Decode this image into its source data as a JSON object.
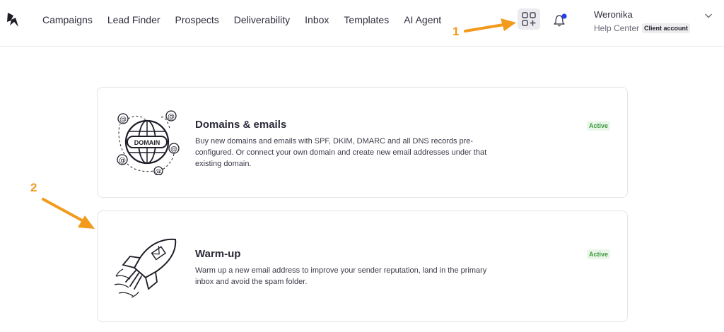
{
  "nav": {
    "items": [
      {
        "label": "Campaigns"
      },
      {
        "label": "Lead Finder"
      },
      {
        "label": "Prospects"
      },
      {
        "label": "Deliverability"
      },
      {
        "label": "Inbox"
      },
      {
        "label": "Templates"
      },
      {
        "label": "AI Agent"
      }
    ]
  },
  "header": {
    "logo_icon": "bird-logo-icon",
    "apps_icon": "apps-grid-plus-icon",
    "notifications_icon": "bell-icon",
    "notification_dot_color": "#2540e6"
  },
  "user": {
    "name": "Weronika",
    "help_center": "Help Center",
    "account_badge": "Client account"
  },
  "cards": [
    {
      "title": "Domains & emails",
      "description": "Buy new domains and emails with SPF, DKIM, DMARC and all DNS records pre-configured. Or connect your own domain and create new email addresses under that existing domain.",
      "status": "Active",
      "illustration_label": "DOMAIN",
      "illustration_icon": "domain-globe-icon"
    },
    {
      "title": "Warm-up",
      "description": "Warm up a new email address to improve your sender reputation, land in the primary inbox and avoid the spam folder.",
      "status": "Active",
      "illustration_icon": "rocket-icon"
    }
  ],
  "annotations": {
    "label_1": "1",
    "label_2": "2",
    "color": "#f29a1c"
  }
}
